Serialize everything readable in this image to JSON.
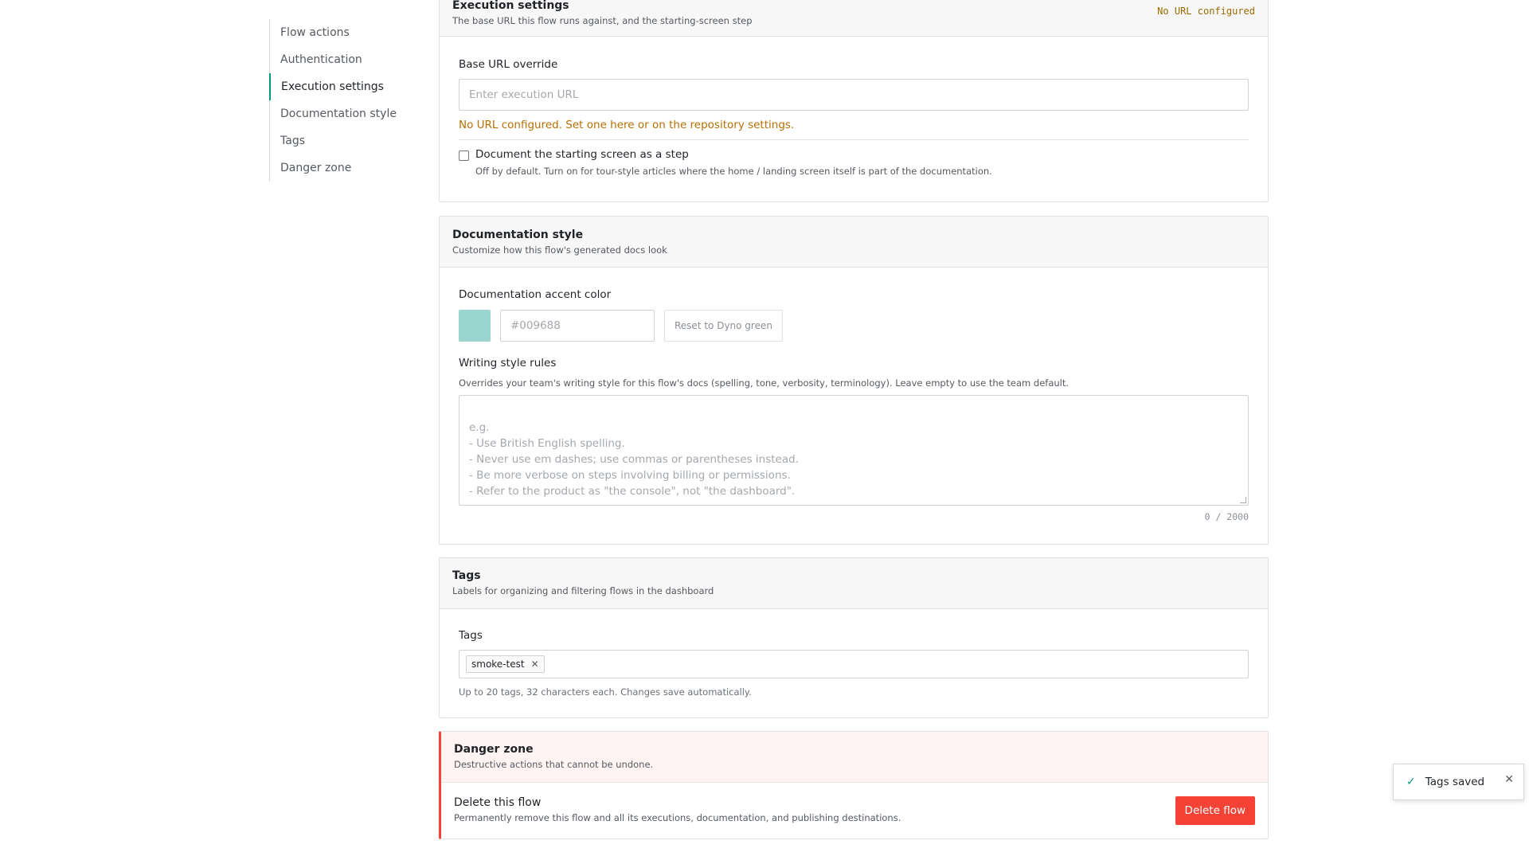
{
  "sidebar": {
    "items": [
      {
        "label": "Flow actions"
      },
      {
        "label": "Authentication"
      },
      {
        "label": "Execution settings",
        "active": true
      },
      {
        "label": "Documentation style"
      },
      {
        "label": "Tags"
      },
      {
        "label": "Danger zone"
      }
    ]
  },
  "execution": {
    "title": "Execution settings",
    "subtitle": "The base URL this flow runs against, and the starting-screen step",
    "badge": "No URL configured",
    "base_url_label": "Base URL override",
    "base_url_placeholder": "Enter execution URL",
    "base_url_value": "",
    "warning": "No URL configured. Set one here or on the repository settings.",
    "start_step_label": "Document the starting screen as a step",
    "start_step_help": "Off by default. Turn on for tour-style articles where the home / landing screen itself is part of the documentation.",
    "start_step_checked": false
  },
  "doc_style": {
    "title": "Documentation style",
    "subtitle": "Customize how this flow's generated docs look",
    "accent_label": "Documentation accent color",
    "accent_swatch_color": "#9ad5cf",
    "accent_placeholder": "#009688",
    "reset_label": "Reset to Dyno green",
    "rules_label": "Writing style rules",
    "rules_help": "Overrides your team's writing style for this flow's docs (spelling, tone, verbosity, terminology). Leave empty to use the team default.",
    "rules_placeholder": "e.g.\n- Use British English spelling.\n- Never use em dashes; use commas or parentheses instead.\n- Be more verbose on steps involving billing or permissions.\n- Refer to the product as \"the console\", not \"the dashboard\".",
    "counter": "0 / 2000"
  },
  "tags": {
    "title": "Tags",
    "subtitle": "Labels for organizing and filtering flows in the dashboard",
    "field_label": "Tags",
    "chips": [
      {
        "label": "smoke-test"
      }
    ],
    "help": "Up to 20 tags, 32 characters each. Changes save automatically."
  },
  "danger": {
    "title": "Danger zone",
    "subtitle": "Destructive actions that cannot be undone.",
    "delete_title": "Delete this flow",
    "delete_desc": "Permanently remove this flow and all its executions, documentation, and publishing destinations.",
    "delete_button": "Delete flow"
  },
  "toast": {
    "text": "Tags saved",
    "icon": "check-icon",
    "close_icon": "close-icon"
  },
  "colors": {
    "accent": "#009688",
    "danger": "#f44336",
    "warning": "#b86e00"
  }
}
